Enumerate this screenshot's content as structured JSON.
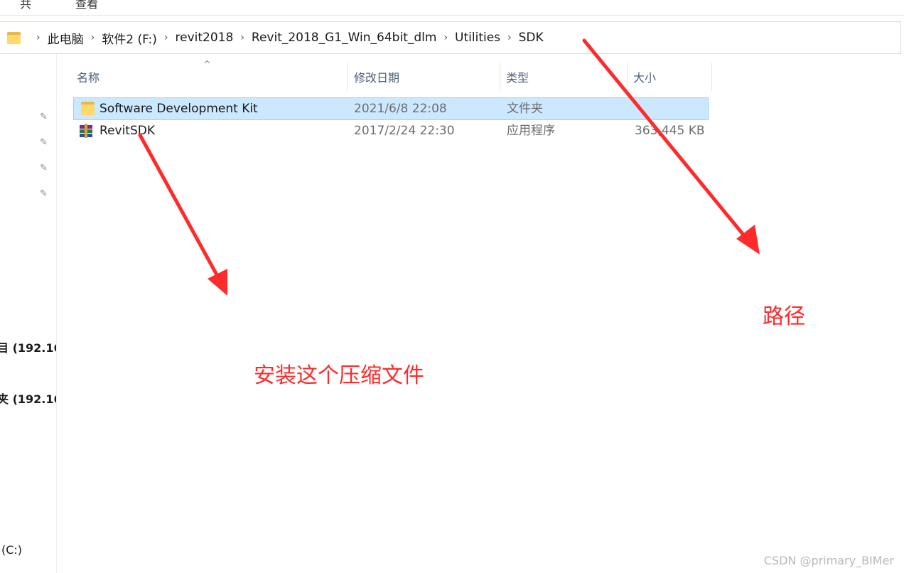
{
  "top": {
    "left_fragment": "共",
    "mid_fragment": "查看"
  },
  "address_bar": {
    "crumbs": [
      "此电脑",
      "软件2 (F:)",
      "revit2018",
      "Revit_2018_G1_Win_64bit_dlm",
      "Utilities",
      "SDK"
    ],
    "separator": "›"
  },
  "nav": {
    "pin_glyph": "✎",
    "items": [
      "目 (192.16",
      "夹 (192.16",
      "(C:)"
    ]
  },
  "columns": {
    "name": "名称",
    "date": "修改日期",
    "type": "类型",
    "size": "大小",
    "sort_glyph": "^"
  },
  "files": [
    {
      "name": "Software Development Kit",
      "date": "2021/6/8 22:08",
      "type": "文件夹",
      "size": "",
      "icon": "folder-icon",
      "selected": true
    },
    {
      "name": "RevitSDK",
      "date": "2017/2/24 22:30",
      "type": "应用程序",
      "size": "363,445 KB",
      "icon": "winrar-archive-icon",
      "selected": false
    }
  ],
  "annotations": {
    "install": "安装这个压缩文件",
    "path": "路径"
  },
  "watermark": "CSDN @primary_BIMer",
  "colors": {
    "annotation": "#ff2a2a",
    "selection": "#cce8ff",
    "folder": "#ffd867"
  }
}
